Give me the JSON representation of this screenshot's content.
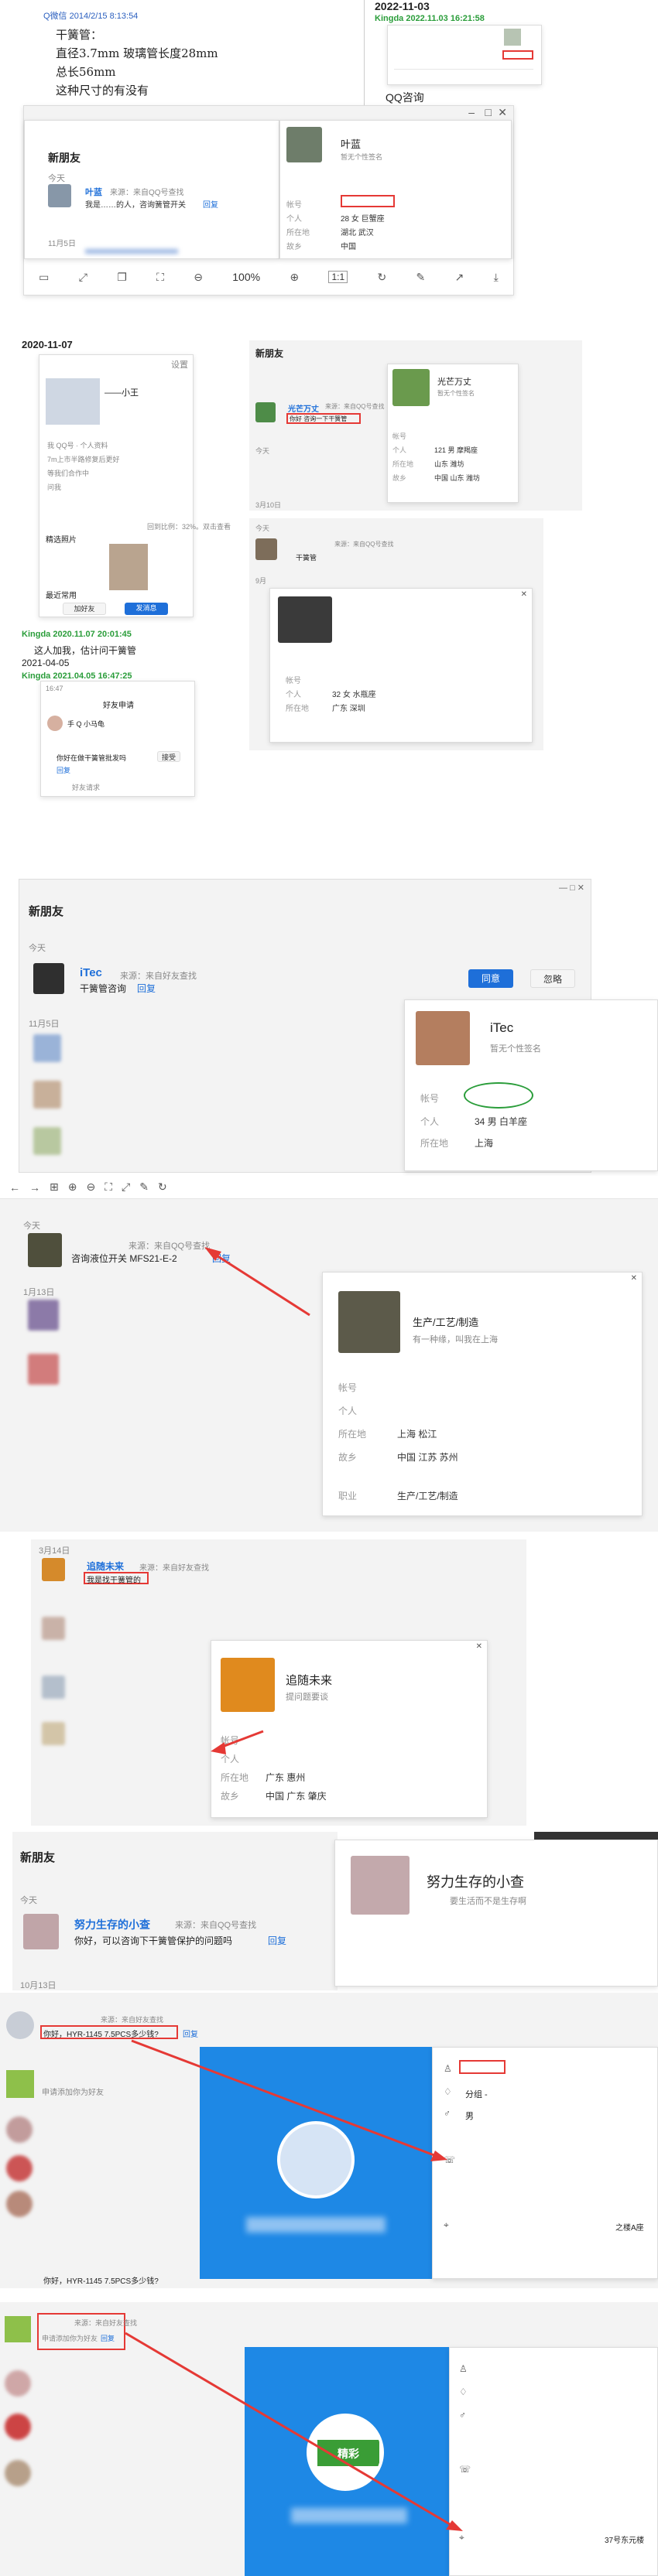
{
  "s1": {
    "note_ts": "Q微信 2014/2/15 8:13:54",
    "note_lines": [
      "干簧管：",
      "直径3.7mm  玻璃管长度28mm",
      "总长56mm",
      "这种尺寸的有没有"
    ],
    "right_date": "2022-11-03",
    "right_ts": "Kingda 2022.11.03 16:21:58",
    "qq_consult": "QQ咨询",
    "panel_title": "新朋友",
    "today": "今天",
    "friend_name": "叶蓝",
    "friend_source": "来源：来自QQ号查找",
    "friend_msg": "我是……的人，咨询簧管开关",
    "reply": "回复",
    "date2": "11月5日",
    "card_name": "叶蓝",
    "card_sig": "暂无个性签名",
    "card_fields": [
      [
        "帐号",
        ""
      ],
      [
        "个人",
        "28 女 巨蟹座"
      ],
      [
        "所在地",
        "湖北 武汉"
      ],
      [
        "故乡",
        "中国"
      ]
    ],
    "zoom": "100%",
    "ratio": "1:1"
  },
  "s2": {
    "date": "2020-11-07",
    "phone_title": "设置",
    "phone_user": "——小王",
    "phone_items": [
      "我 QQ号 · 个人资料",
      "7m上市半路修复后更好",
      "等我们合作中",
      "问我"
    ],
    "featured": "精选照片",
    "recent": "最近常用",
    "add_friend": "加好友",
    "send_msg": "发消息",
    "pct_note": "回到比例：32%。双击查看",
    "ts1": "Kingda 2020.11.07 20:01:45",
    "msg1": "这人加我，估计问干簧管",
    "date3": "2021-04-05",
    "ts2": "Kingda 2021.04.05 16:47:25",
    "phone2_title": "好友申请",
    "phone2_time": "16:47",
    "phone2_user": "手 Q 小马龟",
    "phone2_msg": "你好在做干簧管批发吗",
    "phone2_btn": "接受",
    "phone2_reply": "回复",
    "phone2_foot": "好友请求",
    "panel_title": "新朋友",
    "friend_name": "光芒万丈",
    "friend_source": "来源：来自QQ号查找",
    "friend_msg": "你好 咨询一下干簧管",
    "today": "今天",
    "date_3_10": "3月10日",
    "card_name": "光芒万丈",
    "card_sig": "暂无个性签名",
    "card_fields": [
      [
        "帐号",
        ""
      ],
      [
        "个人",
        "121 男 摩羯座"
      ],
      [
        "所在地",
        "山东 潍坊"
      ],
      [
        "故乡",
        "中国 山东 潍坊"
      ]
    ],
    "panel2_today": "今天",
    "friend2_name": "",
    "friend2_msg": "干簧管",
    "friend2_source": "来源：来自QQ号查找",
    "date_9": "9月",
    "card2_fields": [
      [
        "帐号",
        ""
      ],
      [
        "个人",
        "32 女 水瓶座"
      ],
      [
        "所在地",
        "广东 深圳"
      ]
    ]
  },
  "s3": {
    "panel_title": "新朋友",
    "today": "今天",
    "friend_name": "iTec",
    "friend_source": "来源：来自好友查找",
    "friend_msg": "干簧管咨询",
    "reply": "回复",
    "agree": "同意",
    "ignore": "忽略",
    "date": "11月5日",
    "card_name": "iTec",
    "card_sig": "暂无个性签名",
    "card_fields": [
      [
        "帐号",
        ""
      ],
      [
        "个人",
        "34 男 白羊座"
      ],
      [
        "所在地",
        "上海"
      ]
    ]
  },
  "s4": {
    "panel_title": "新朋友",
    "today": "今天",
    "friend_source": "来源：来自QQ号查找",
    "friend_msg": "咨询液位开关 MFS21-E-2",
    "reply": "回复",
    "date": "1月13日",
    "card_job": "生产/工艺/制造",
    "card_sig": "有一种缘，叫我在上海",
    "card_fields": [
      [
        "帐号",
        ""
      ],
      [
        "个人",
        ""
      ],
      [
        "所在地",
        "上海 松江"
      ],
      [
        "故乡",
        "中国 江苏 苏州"
      ],
      [
        "职业",
        "生产/工艺/制造"
      ]
    ]
  },
  "s5": {
    "date": "3月14日",
    "friend_name": "追随未来",
    "friend_source": "来源：来自好友查找",
    "friend_msg": "我是找干簧管的",
    "card_name": "追随未来",
    "card_sig": "提问题要谈",
    "card_fields": [
      [
        "帐号",
        ""
      ],
      [
        "个人",
        ""
      ],
      [
        "所在地",
        "广东 惠州"
      ],
      [
        "故乡",
        "中国 广东 肇庆"
      ]
    ]
  },
  "s6": {
    "panel_title": "新朋友",
    "today": "今天",
    "friend_name": "努力生存的小查",
    "friend_source": "来源：来自QQ号查找",
    "friend_msg": "你好，可以咨询下干簧管保护的问题吗",
    "reply": "回复",
    "date": "10月13日",
    "card_name": "努力生存的小查",
    "card_sig": "要生活而不是生存啊"
  },
  "s7": {
    "msg1": "你好，HYR-1145  7.5PCS多少钱?",
    "reply": "回复",
    "source": "来源：来自好友查找",
    "apply": "申请添加你为好友",
    "gender": "男",
    "group": "分组 -",
    "msg_bottom": "你好，HYR-1145  7.5PCS多少钱?",
    "address_tail": "之楼A座",
    "green_badge": "精彩"
  },
  "s8": {
    "apply": "申请添加你为好友",
    "reply": "回复",
    "source": "来源：来自好友查找",
    "badge": "精彩",
    "address_tail": "37号东元楼"
  },
  "colors": {
    "qq_blue": "#1e6fd9",
    "card_blue": "#1da1f2",
    "red": "#e53935",
    "green": "#2a9d3a"
  }
}
